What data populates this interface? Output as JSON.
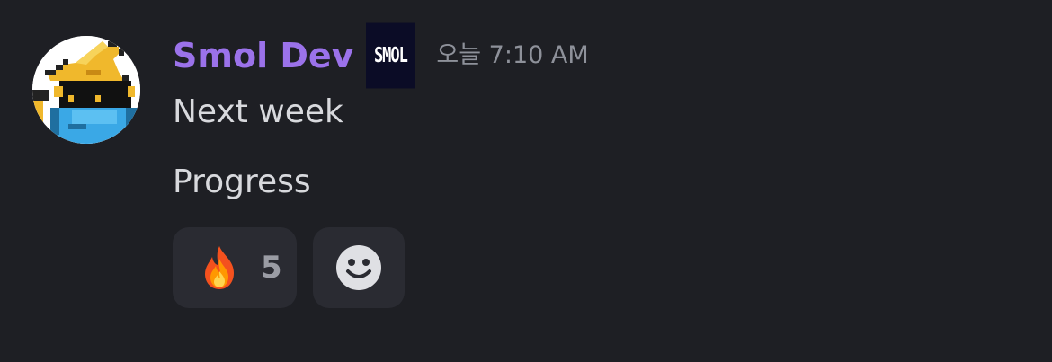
{
  "message": {
    "author": "Smol Dev",
    "server_tag": "SMOL",
    "timestamp": "오늘 7:10 AM",
    "lines": [
      "Next week",
      "Progress"
    ],
    "author_color": "#9b72ea"
  },
  "avatar": {
    "icon": "pixel-wizard-avatar"
  },
  "reactions": [
    {
      "icon": "fire-emoji",
      "count": "5"
    }
  ],
  "add_reaction": {
    "icon": "smiley-add-reaction-icon"
  },
  "colors": {
    "background": "#1e1f24",
    "reaction_bg": "#2a2b32",
    "text": "#d8d9dd",
    "muted": "#8e919a"
  }
}
